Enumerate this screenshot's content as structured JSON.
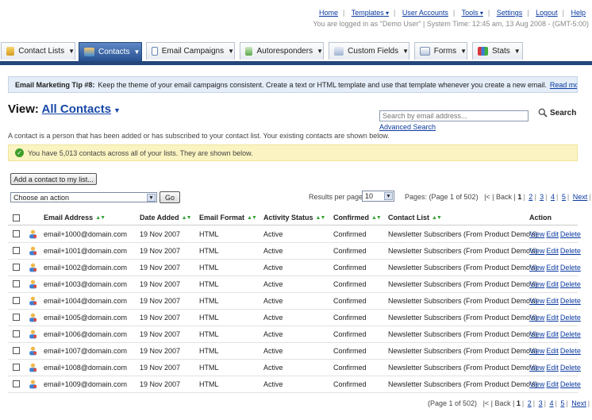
{
  "top_links": [
    {
      "label": "Home",
      "dropdown": false
    },
    {
      "label": "Templates",
      "dropdown": true
    },
    {
      "label": "User Accounts",
      "dropdown": false
    },
    {
      "label": "Tools",
      "dropdown": true
    },
    {
      "label": "Settings",
      "dropdown": false
    },
    {
      "label": "Logout",
      "dropdown": false
    },
    {
      "label": "Help",
      "dropdown": false
    }
  ],
  "status_line": "You are logged in as \"Demo User\" | System Time: 12:45 am, 13 Aug 2008 - (GMT-5:00)",
  "tabs": [
    {
      "label": "Contact Lists",
      "icon": "contact-lists-icon",
      "active": false
    },
    {
      "label": "Contacts",
      "icon": "contacts-icon",
      "active": true
    },
    {
      "label": "Email Campaigns",
      "icon": "email-campaigns-icon",
      "active": false
    },
    {
      "label": "Autoresponders",
      "icon": "autoresponders-icon",
      "active": false
    },
    {
      "label": "Custom Fields",
      "icon": "custom-fields-icon",
      "active": false
    },
    {
      "label": "Forms",
      "icon": "forms-icon",
      "active": false
    },
    {
      "label": "Stats",
      "icon": "stats-icon",
      "active": false
    }
  ],
  "tip": {
    "title": "Email Marketing Tip #8:",
    "text": "Keep the theme of your email campaigns consistent. Create a text or HTML template and use that template whenever you create a new email.",
    "link": "Read more..."
  },
  "view": {
    "prefix": "View:",
    "link": "All Contacts"
  },
  "search": {
    "placeholder": "Search by email address...",
    "button": "Search",
    "advanced": "Advanced Search"
  },
  "description": "A contact is a person that has been added or has subscribed to your contact list. Your existing contacts are shown below.",
  "message": "You have 5,013 contacts across all of your lists. They are shown below.",
  "add_button": "Add a contact to my list...",
  "action_select": "Choose an action",
  "go_button": "Go",
  "results_per_page": {
    "label": "Results per page:",
    "value": "10"
  },
  "pager": {
    "info": "Pages: (Page 1 of 502)",
    "info_bottom": "(Page 1 of 502)",
    "prev": "|< | Back |",
    "pages": [
      "1",
      "2",
      "3",
      "4",
      "5"
    ],
    "next": "Next",
    "last": "»"
  },
  "columns": [
    "Email Address",
    "Date Added",
    "Email Format",
    "Activity Status",
    "Confirmed",
    "Contact List",
    "Action"
  ],
  "row_actions": [
    "View",
    "Edit",
    "Delete"
  ],
  "rows": [
    {
      "email": "email+1000@domain.com",
      "date": "19 Nov 2007",
      "format": "HTML",
      "status": "Active",
      "confirmed": "Confirmed",
      "list": "Newsletter Subscribers (From Product Demo's)"
    },
    {
      "email": "email+1001@domain.com",
      "date": "19 Nov 2007",
      "format": "HTML",
      "status": "Active",
      "confirmed": "Confirmed",
      "list": "Newsletter Subscribers (From Product Demo's)"
    },
    {
      "email": "email+1002@domain.com",
      "date": "19 Nov 2007",
      "format": "HTML",
      "status": "Active",
      "confirmed": "Confirmed",
      "list": "Newsletter Subscribers (From Product Demo's)"
    },
    {
      "email": "email+1003@domain.com",
      "date": "19 Nov 2007",
      "format": "HTML",
      "status": "Active",
      "confirmed": "Confirmed",
      "list": "Newsletter Subscribers (From Product Demo's)"
    },
    {
      "email": "email+1004@domain.com",
      "date": "19 Nov 2007",
      "format": "HTML",
      "status": "Active",
      "confirmed": "Confirmed",
      "list": "Newsletter Subscribers (From Product Demo's)"
    },
    {
      "email": "email+1005@domain.com",
      "date": "19 Nov 2007",
      "format": "HTML",
      "status": "Active",
      "confirmed": "Confirmed",
      "list": "Newsletter Subscribers (From Product Demo's)"
    },
    {
      "email": "email+1006@domain.com",
      "date": "19 Nov 2007",
      "format": "HTML",
      "status": "Active",
      "confirmed": "Confirmed",
      "list": "Newsletter Subscribers (From Product Demo's)"
    },
    {
      "email": "email+1007@domain.com",
      "date": "19 Nov 2007",
      "format": "HTML",
      "status": "Active",
      "confirmed": "Confirmed",
      "list": "Newsletter Subscribers (From Product Demo's)"
    },
    {
      "email": "email+1008@domain.com",
      "date": "19 Nov 2007",
      "format": "HTML",
      "status": "Active",
      "confirmed": "Confirmed",
      "list": "Newsletter Subscribers (From Product Demo's)"
    },
    {
      "email": "email+1009@domain.com",
      "date": "19 Nov 2007",
      "format": "HTML",
      "status": "Active",
      "confirmed": "Confirmed",
      "list": "Newsletter Subscribers (From Product Demo's)"
    }
  ],
  "colors": {
    "accent": "#24467a",
    "link": "#0a3aa0",
    "tip_bg": "#e4edf8",
    "message_bg": "#fbf4c2",
    "sort_arrow": "#39a139"
  }
}
